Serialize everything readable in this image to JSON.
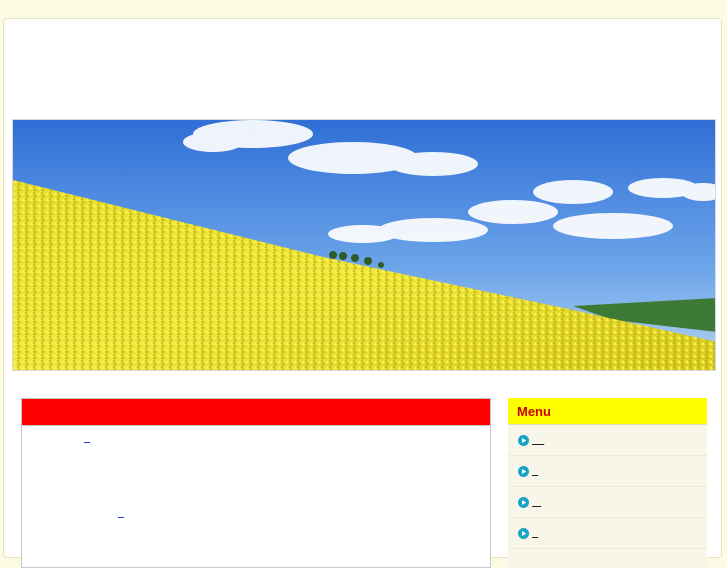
{
  "main": {
    "links": [
      {
        "label": "  "
      },
      {
        "label": "  "
      }
    ]
  },
  "sidebar": {
    "title": "Menu",
    "items": [
      {
        "label": "    "
      },
      {
        "label": "  "
      },
      {
        "label": "   "
      },
      {
        "label": "  "
      }
    ]
  },
  "colors": {
    "page_background": "#fdfbe3",
    "main_heading_bar": "#ff0000",
    "menu_title_bar": "#ffff00",
    "menu_title_text": "#cc0000",
    "menu_icon": "#1aa3c8"
  },
  "icons": {
    "menu_item": "play-circle-icon"
  }
}
